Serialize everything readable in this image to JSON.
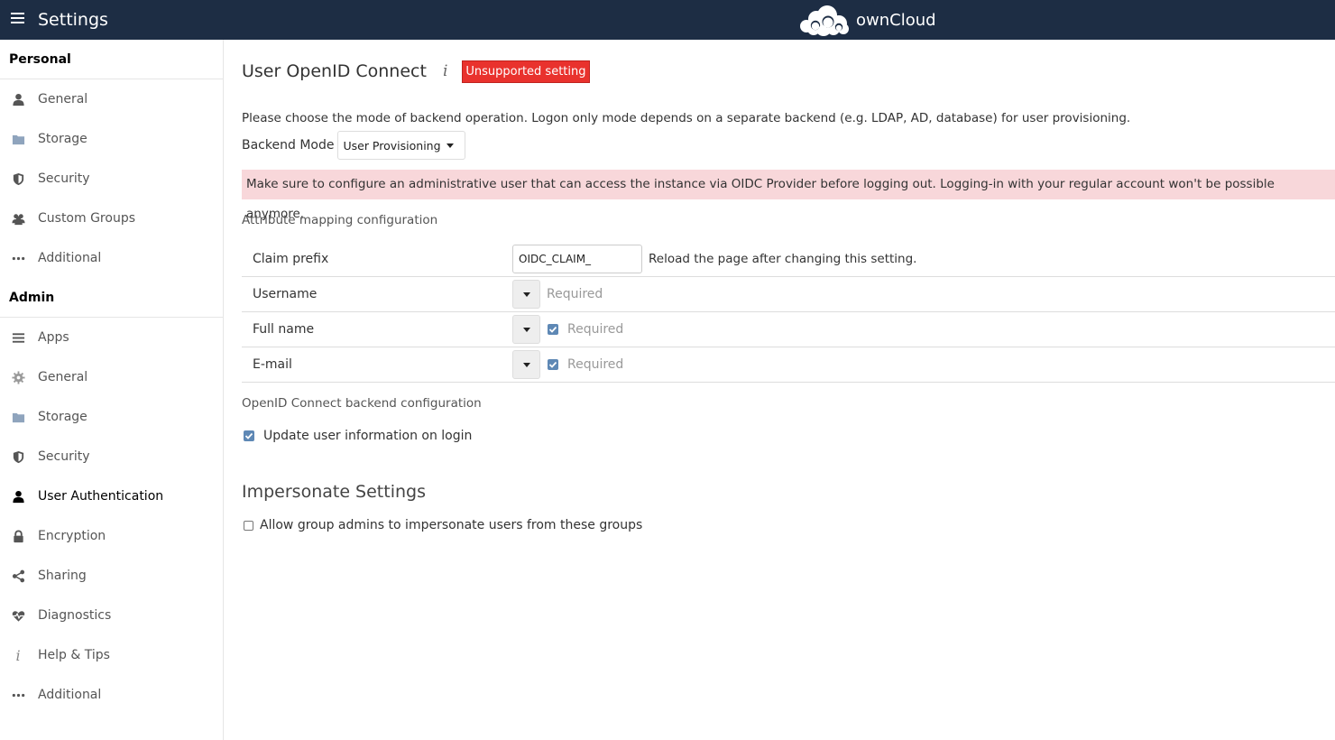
{
  "header": {
    "title": "Settings",
    "brand": "ownCloud",
    "menu_icon": "hamburger-icon"
  },
  "sidebar": {
    "personal": {
      "heading": "Personal",
      "items": [
        {
          "label": "General",
          "icon": "user-icon"
        },
        {
          "label": "Storage",
          "icon": "folder-icon"
        },
        {
          "label": "Security",
          "icon": "shield-icon"
        },
        {
          "label": "Custom Groups",
          "icon": "users-icon"
        },
        {
          "label": "Additional",
          "icon": "more-icon"
        }
      ]
    },
    "admin": {
      "heading": "Admin",
      "items": [
        {
          "label": "Apps",
          "icon": "list-icon"
        },
        {
          "label": "General",
          "icon": "gear-icon"
        },
        {
          "label": "Storage",
          "icon": "folder-icon"
        },
        {
          "label": "Security",
          "icon": "shield-icon"
        },
        {
          "label": "User Authentication",
          "icon": "user-icon",
          "active": true
        },
        {
          "label": "Encryption",
          "icon": "lock-icon"
        },
        {
          "label": "Sharing",
          "icon": "share-icon"
        },
        {
          "label": "Diagnostics",
          "icon": "heartbeat-icon"
        },
        {
          "label": "Help & Tips",
          "icon": "info-icon"
        },
        {
          "label": "Additional",
          "icon": "more-icon"
        }
      ]
    }
  },
  "main": {
    "title": "User OpenID Connect",
    "info_icon": "i",
    "badge": "Unsupported setting",
    "description": "Please choose the mode of backend operation. Logon only mode depends on a separate backend (e.g. LDAP, AD, database) for user provisioning.",
    "backend_mode_label": "Backend Mode",
    "backend_mode_value": "User Provisioning",
    "warning": "Make sure to configure an administrative user that can access the instance via OIDC Provider before logging out. Logging-in with your regular account won't be possible anymore.",
    "attribute_heading": "Attribute mapping configuration",
    "claim_prefix_label": "Claim prefix",
    "claim_prefix_value": "OIDC_CLAIM_",
    "claim_prefix_note": "Reload the page after changing this setting.",
    "mappings": [
      {
        "label": "Username",
        "required_label": "Required",
        "has_checkbox": false
      },
      {
        "label": "Full name",
        "required_label": "Required",
        "has_checkbox": true,
        "checked": true
      },
      {
        "label": "E-mail",
        "required_label": "Required",
        "has_checkbox": true,
        "checked": true
      }
    ],
    "backend_heading": "OpenID Connect backend configuration",
    "update_label": "Update user information on login",
    "update_checked": true,
    "impersonate_heading": "Impersonate Settings",
    "impersonate_label": "Allow group admins to impersonate users from these groups",
    "impersonate_checked": false
  },
  "colors": {
    "header_bg": "#1d2d44",
    "badge_bg": "#e9322d",
    "warning_bg": "#f8d7da",
    "checkbox": "#5e88b5"
  }
}
